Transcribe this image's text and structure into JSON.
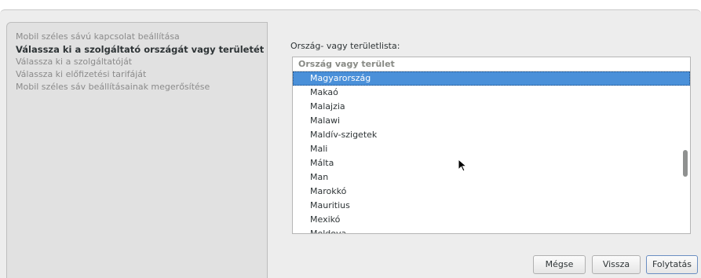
{
  "sidebar": {
    "steps": [
      {
        "label": "Mobil széles sávú kapcsolat beállítása",
        "active": false
      },
      {
        "label": "Válassza ki a szolgáltató országát vagy területét",
        "active": true
      },
      {
        "label": "Válassza ki a szolgáltatóját",
        "active": false
      },
      {
        "label": "Válassza ki előfizetési tarifáját",
        "active": false
      },
      {
        "label": "Mobil széles sáv beállításainak megerősítése",
        "active": false
      }
    ]
  },
  "main": {
    "list_label": "Ország- vagy területlista:",
    "column_header": "Ország vagy terület",
    "items": [
      "Magyarország",
      "Makaó",
      "Malajzia",
      "Malawi",
      "Maldív-szigetek",
      "Mali",
      "Málta",
      "Man",
      "Marokkó",
      "Mauritius",
      "Mexikó",
      "Moldova"
    ],
    "selected_item": "Magyarország"
  },
  "buttons": {
    "cancel": "Mégse",
    "back": "Vissza",
    "next": "Folytatás"
  },
  "colors": {
    "selection": "#4a90d9",
    "window_bg": "#ededed",
    "sidebar_bg": "#e1e1e1"
  }
}
